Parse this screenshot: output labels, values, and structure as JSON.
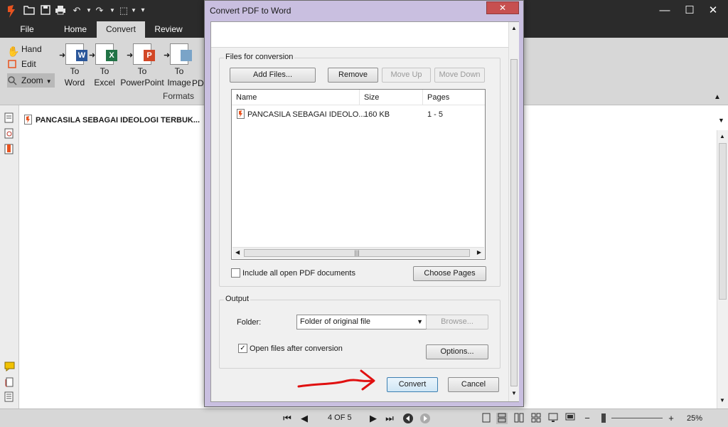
{
  "quick_access": {
    "icons": [
      "foxit-logo-icon",
      "open-folder-icon",
      "save-icon",
      "print-icon",
      "undo-icon",
      "redo-icon",
      "select-tool-icon",
      "customize-icon"
    ]
  },
  "window": {
    "minimize": "—",
    "maximize": "☐",
    "close": "✕"
  },
  "tabs": [
    {
      "label": "File"
    },
    {
      "label": "Home"
    },
    {
      "label": "Convert"
    },
    {
      "label": "Review"
    }
  ],
  "ribbon": {
    "tools": [
      {
        "label": "Hand"
      },
      {
        "label": "Edit"
      },
      {
        "label": "Zoom"
      }
    ],
    "convert_buttons": [
      {
        "line1": "To",
        "line2": "Word",
        "badge": "W",
        "color": "#2b579a"
      },
      {
        "line1": "To",
        "line2": "Excel",
        "badge": "X",
        "color": "#217346"
      },
      {
        "line1": "To",
        "line2": "PowerPoint",
        "badge": "P",
        "color": "#d24726"
      },
      {
        "line1": "To",
        "line2": "Image",
        "badge": "",
        "color": "#8a8a8a"
      },
      {
        "line1": "",
        "line2": "PD",
        "badge": "",
        "color": "#8a8a8a"
      }
    ],
    "group_label": "Formats"
  },
  "document_tab": {
    "title": "PANCASILA SEBAGAI IDEOLOGI TERBUK...",
    "close": "✕"
  },
  "statusbar": {
    "page": "4 OF 5",
    "zoom": "25%",
    "zoom_minus": "−",
    "zoom_plus": "+"
  },
  "dialog": {
    "title": "Convert PDF to Word",
    "close": "✕",
    "files_group": {
      "title": "Files for conversion",
      "add_files": "Add Files...",
      "remove": "Remove",
      "move_up": "Move Up",
      "move_down": "Move Down",
      "columns": [
        "Name",
        "Size",
        "Pages"
      ],
      "rows": [
        {
          "name": "PANCASILA SEBAGAI IDEOLO...",
          "size": "160 KB",
          "pages": "1 - 5"
        }
      ],
      "include_all": "Include all open PDF documents",
      "include_all_checked": false,
      "choose_pages": "Choose Pages"
    },
    "output_group": {
      "title": "Output",
      "folder_label": "Folder:",
      "folder_value": "Folder of original file",
      "browse": "Browse...",
      "open_after": "Open files after conversion",
      "open_after_checked": true,
      "options": "Options..."
    },
    "convert": "Convert",
    "cancel": "Cancel",
    "annotation_color": "#e01010"
  }
}
